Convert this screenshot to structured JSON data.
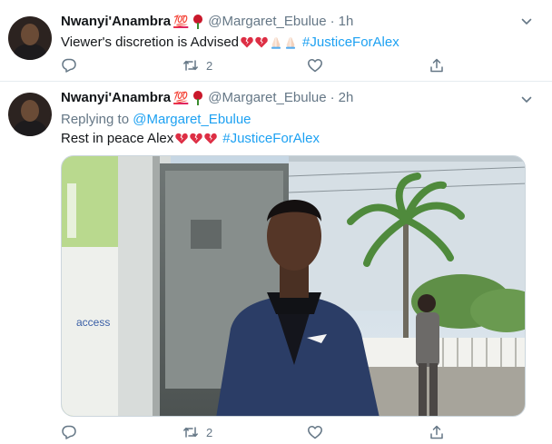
{
  "tweets": [
    {
      "user": {
        "name": "Nwanyi'Anambra",
        "badge": "💯",
        "handle": "@Margaret_Ebulue"
      },
      "separator": "·",
      "time": "1h",
      "text": "Viewer's discretion is Advised",
      "hashtag": "#JusticeForAlex",
      "emoji_icons": [
        "broken-heart-icon",
        "broken-heart-icon",
        "folded-hands-icon",
        "folded-hands-icon"
      ],
      "stats": {
        "replies": "",
        "retweets": "2",
        "likes": ""
      }
    },
    {
      "user": {
        "name": "Nwanyi'Anambra",
        "badge": "💯",
        "handle": "@Margaret_Ebulue"
      },
      "separator": "·",
      "time": "2h",
      "replying_label": "Replying to",
      "replying_to": "@Margaret_Ebulue",
      "text": "Rest in peace Alex",
      "hashtag": "#JusticeForAlex",
      "emoji_icons": [
        "broken-heart-icon",
        "broken-heart-icon",
        "broken-heart-icon"
      ],
      "photo": {
        "sign_text": "access"
      },
      "stats": {
        "replies": "",
        "retweets": "2",
        "likes": ""
      }
    }
  ],
  "colors": {
    "accent": "#1da1f2",
    "muted": "#657786",
    "text": "#14171a",
    "broken_heart": "#dd2e44"
  }
}
